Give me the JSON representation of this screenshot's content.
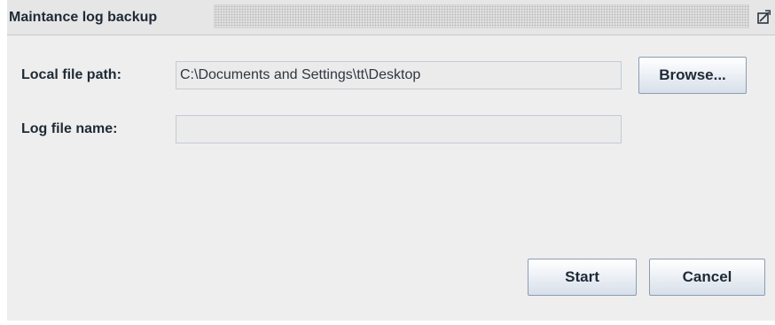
{
  "window": {
    "title": "Maintance log backup"
  },
  "form": {
    "local_file_path": {
      "label": "Local file path:",
      "value": "C:\\Documents and Settings\\tt\\Desktop"
    },
    "log_file_name": {
      "label": "Log file name:",
      "value": ""
    }
  },
  "buttons": {
    "browse": "Browse...",
    "start": "Start",
    "cancel": "Cancel"
  },
  "icons": {
    "maximize": "maximize-icon"
  },
  "colors": {
    "dialog_background": "#eeeeee",
    "field_background": "#ebebeb",
    "field_border": "#c3cbd6",
    "button_border": "#8a9db3",
    "text": "#1f2a36"
  }
}
